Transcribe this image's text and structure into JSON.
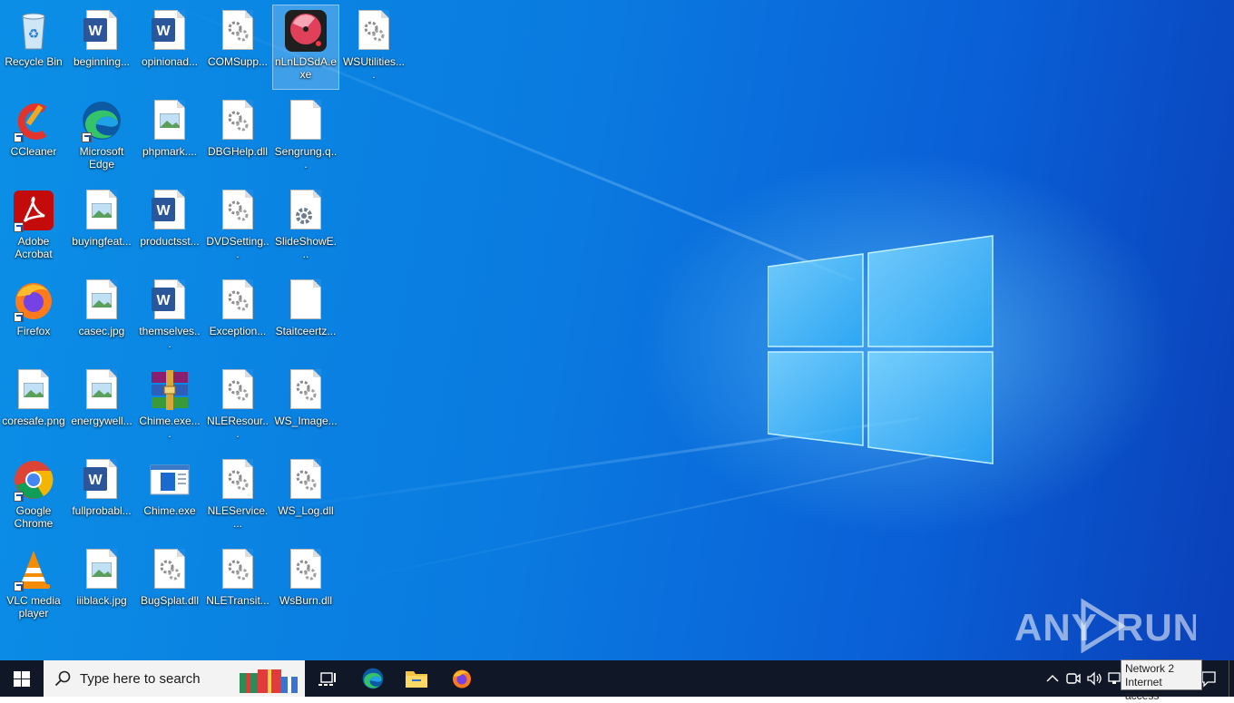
{
  "desktop": {
    "icons": [
      {
        "label": "Recycle Bin"
      },
      {
        "label": "beginning..."
      },
      {
        "label": "opinionad..."
      },
      {
        "label": "COMSupp..."
      },
      {
        "label": "nLnLDSdA.exe"
      },
      {
        "label": "WSUtilities...."
      },
      {
        "label": "CCleaner"
      },
      {
        "label": "Microsoft Edge"
      },
      {
        "label": "phpmark...."
      },
      {
        "label": "DBGHelp.dll"
      },
      {
        "label": "Sengrung.q..."
      },
      {
        "label": "Adobe Acrobat"
      },
      {
        "label": "buyingfeat..."
      },
      {
        "label": "productsst..."
      },
      {
        "label": "DVDSetting..."
      },
      {
        "label": "SlideShowE..."
      },
      {
        "label": "Firefox"
      },
      {
        "label": "casec.jpg"
      },
      {
        "label": "themselves..."
      },
      {
        "label": "Exception..."
      },
      {
        "label": "Staitceertz..."
      },
      {
        "label": "coresafe.png"
      },
      {
        "label": "energywell..."
      },
      {
        "label": "Chime.exe...."
      },
      {
        "label": "NLEResour..."
      },
      {
        "label": "WS_Image..."
      },
      {
        "label": "Google Chrome"
      },
      {
        "label": "fullprobabl..."
      },
      {
        "label": "Chime.exe"
      },
      {
        "label": "NLEService...."
      },
      {
        "label": "WS_Log.dll"
      },
      {
        "label": "VLC media player"
      },
      {
        "label": "iiiblack.jpg"
      },
      {
        "label": "BugSplat.dll"
      },
      {
        "label": "NLETransit..."
      },
      {
        "label": "WsBurn.dll"
      }
    ],
    "watermark": "ANY RUN"
  },
  "taskbar": {
    "search_placeholder": "Type here to search",
    "tooltip_line1": "Network 2",
    "tooltip_line2": "Internet access"
  },
  "colors": {
    "taskbar_bg": "#101828",
    "desktop_blue": "#0a7ae0"
  }
}
